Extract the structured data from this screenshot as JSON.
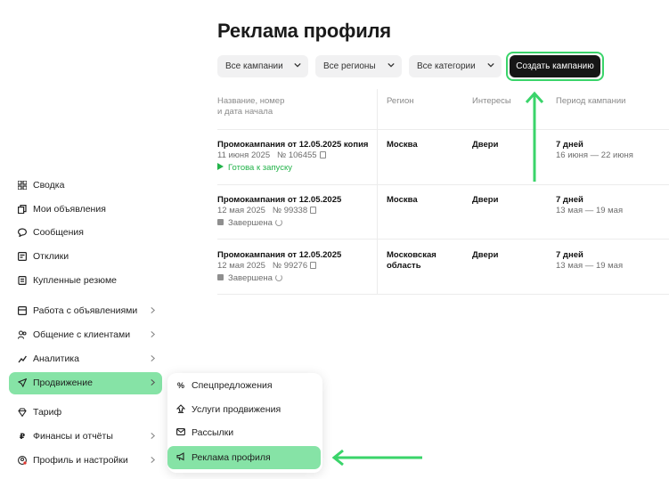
{
  "page": {
    "title": "Реклама профиля"
  },
  "filters": {
    "campaigns": "Все кампании",
    "regions": "Все регионы",
    "categories": "Все категории",
    "create_button": "Создать кампанию"
  },
  "table": {
    "headers": {
      "name_line1": "Название, номер",
      "name_line2": "и дата начала",
      "region": "Регион",
      "interests": "Интересы",
      "period": "Период кампании"
    },
    "rows": [
      {
        "name": "Промокампания от 12.05.2025 копия",
        "date": "11 июня 2025",
        "number": "№ 106455",
        "status": "Готова к запуску",
        "region1": "Москва",
        "region2": "",
        "interests": "Двери",
        "days": "7 дней",
        "range": "16 июня — 22 июня"
      },
      {
        "name": "Промокампания от 12.05.2025",
        "date": "12 мая 2025",
        "number": "№ 99338",
        "status": "Завершена",
        "region1": "Москва",
        "region2": "",
        "interests": "Двери",
        "days": "7 дней",
        "range": "13 мая — 19 мая"
      },
      {
        "name": "Промокампания от 12.05.2025",
        "date": "12 мая 2025",
        "number": "№ 99276",
        "status": "Завершена",
        "region1": "Московская",
        "region2": "область",
        "interests": "Двери",
        "days": "7 дней",
        "range": "13 мая — 19 мая"
      }
    ]
  },
  "sidebar": {
    "items": [
      {
        "label": "Сводка",
        "icon": "grid-icon"
      },
      {
        "label": "Мои объявления",
        "icon": "copy-icon"
      },
      {
        "label": "Сообщения",
        "icon": "chat-icon"
      },
      {
        "label": "Отклики",
        "icon": "response-icon"
      },
      {
        "label": "Купленные резюме",
        "icon": "document-icon"
      },
      {
        "label": "Работа с объявлениями",
        "icon": "list-icon"
      },
      {
        "label": "Общение с клиентами",
        "icon": "users-icon"
      },
      {
        "label": "Аналитика",
        "icon": "chart-icon"
      },
      {
        "label": "Продвижение",
        "icon": "rocket-icon"
      },
      {
        "label": "Тариф",
        "icon": "diamond-icon"
      },
      {
        "label": "Финансы и отчёты",
        "icon": "ruble-icon"
      },
      {
        "label": "Профиль и настройки",
        "icon": "profile-settings-icon"
      }
    ]
  },
  "submenu": {
    "items": [
      {
        "label": "Спецпредложения",
        "icon": "percent-icon"
      },
      {
        "label": "Услуги продвижения",
        "icon": "upload-icon"
      },
      {
        "label": "Рассылки",
        "icon": "mail-icon"
      },
      {
        "label": "Реклама профиля",
        "icon": "megaphone-icon"
      }
    ]
  },
  "colors": {
    "accent": "#86e3a6",
    "arrow": "#3ad46a",
    "ready": "#23b34a",
    "button": "#161616"
  }
}
